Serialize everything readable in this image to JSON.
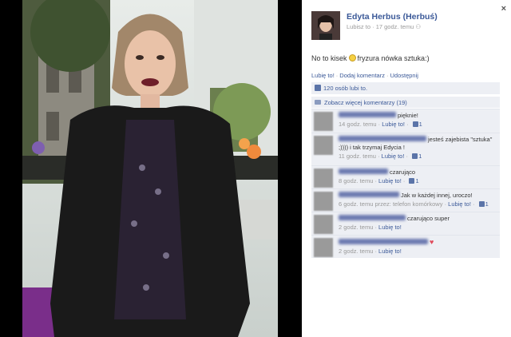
{
  "close_label": "×",
  "author": {
    "name": "Edyta Herbus (Herbuś)",
    "like_label": "Lubisz to",
    "time": "17 godz. temu"
  },
  "post": {
    "text_before": "No to kisek",
    "text_after": "fryzura nówka sztuka:)"
  },
  "actions": {
    "like": "Lubię to!",
    "comment": "Dodaj komentarz",
    "share": "Udostępnij"
  },
  "likes_summary": "120 osób lubi to.",
  "more_comments": "Zobacz więcej komentarzy (19)",
  "comments": [
    {
      "text": "pięknie!",
      "time": "14 godz. temu",
      "like": "Lubię to!",
      "count": "1",
      "via": ""
    },
    {
      "text": "jesteś zajebista \"sztuka\" ;)))) i tak trzymaj Edycia !",
      "time": "11 godz. temu",
      "like": "Lubię to!",
      "count": "1",
      "via": ""
    },
    {
      "text": "czarująco",
      "time": "8 godz. temu",
      "like": "Lubię to!",
      "count": "1",
      "via": ""
    },
    {
      "text": "Jak w każdej innej, uroczo!",
      "time": "6 godz. temu przez: telefon komórkowy",
      "like": "Lubię to!",
      "count": "1",
      "via": ""
    },
    {
      "text": "czarująco super",
      "time": "2 godz. temu",
      "like": "Lubię to!",
      "count": "",
      "via": ""
    },
    {
      "text": "",
      "time": "2 godz. temu",
      "like": "Lubię to!",
      "count": "",
      "via": ""
    }
  ],
  "colors": {
    "link": "#3b5998",
    "panel_bg": "#edeff4",
    "heart": "#e04a5a"
  }
}
